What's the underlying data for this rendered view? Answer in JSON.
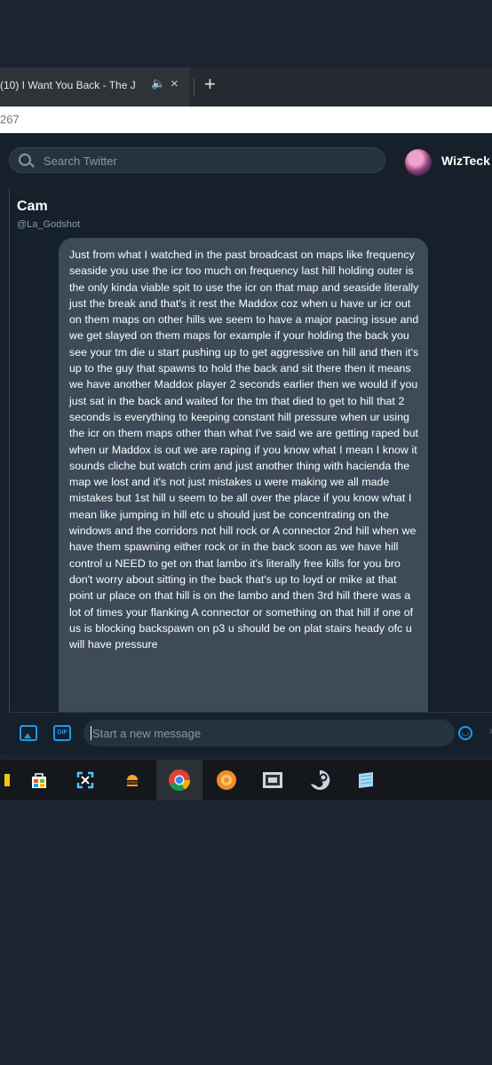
{
  "browser": {
    "tab_title": "(10) I Want You Back - The J",
    "tab_audio_icon": "speaker-icon",
    "tab_close": "×",
    "new_tab": "+",
    "url": "267"
  },
  "header": {
    "search_placeholder": "Search Twitter",
    "profile_name": "WizTeck"
  },
  "conversation": {
    "name": "Cam",
    "handle": "@La_Godshot",
    "message": "Just from what I watched in the past broadcast on maps like frequency seaside you use the icr too much on frequency last hill holding outer is the only kinda viable spit to use the icr on that map and seaside literally just the break and that's it rest the Maddox coz when u have ur icr out on them maps on other hills we seem to have a major pacing issue and we get slayed on them maps for example if your holding the back you see your tm die u start pushing up to get aggressive on hill and then it's up to the guy that spawns to hold the back and sit there then it means we have another Maddox player 2 seconds earlier then we would if you just sat in the back and waited for the tm that died to get to hill that 2 seconds is everything to keeping constant hill pressure when ur using the icr on them maps other than what I've said we are getting raped but when ur Maddox is out we are raping if you know what I mean I know it sounds cliche but watch crim and just another thing with hacienda the map we lost and it's not just mistakes u were making we all made mistakes but 1st hill u seem to be all over the place if you know what I mean like jumping in hill etc u should just be concentrating on the windows and the corridors not hill rock or A connector 2nd hill when we have them spawning either rock or in the back soon as we have hill control u NEED to get on that lambo it's literally free kills for you bro don't worry about sitting in the back that's up to loyd or mike at that point ur place on that hill is on the lambo and then 3rd hill there was a lot of times your flanking A connector or something on that hill if one of us is blocking backspawn on p3 u should be on plat stairs heady ofc u will have pressure"
  },
  "composer": {
    "placeholder": "Start a new message",
    "gif_label": "GIF"
  },
  "taskbar": {
    "icons": [
      "store-icon",
      "snip-icon",
      "burger-app-icon",
      "chrome-icon",
      "orange-app-icon",
      "media-app-icon",
      "steam-icon",
      "notepad-icon"
    ]
  },
  "colors": {
    "accent": "#1d9bf0",
    "background": "#15202b",
    "bubble": "#3d4a58"
  }
}
